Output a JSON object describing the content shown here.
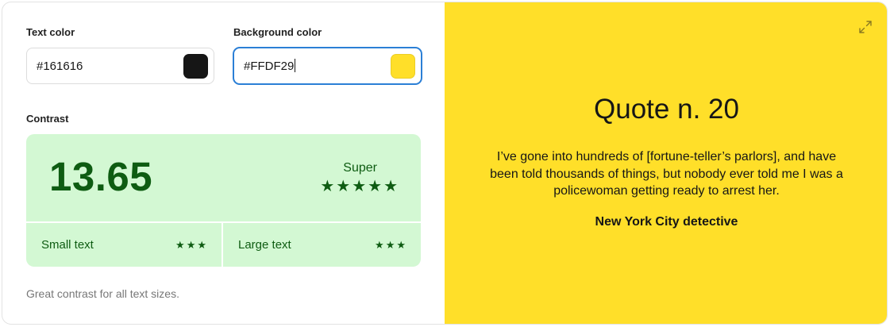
{
  "text_color": {
    "label": "Text color",
    "value": "#161616",
    "swatch": "#161616"
  },
  "background_color": {
    "label": "Background color",
    "value": "#FFDF29",
    "swatch": "#FFDF29"
  },
  "contrast": {
    "label": "Contrast",
    "ratio": "13.65",
    "rating": "Super",
    "rating_stars": 5,
    "small_text": {
      "label": "Small text",
      "stars": 3
    },
    "large_text": {
      "label": "Large text",
      "stars": 3
    },
    "accent_color": "#0e5c12",
    "panel_color": "#d3f8d3"
  },
  "note": "Great contrast for all text sizes.",
  "preview": {
    "title": "Quote n. 20",
    "quote": "I’ve gone into hundreds of [fortune-teller’s parlors], and have been told thousands of things, but nobody ever told me I was a policewoman getting ready to arrest her.",
    "author": "New York City detective",
    "expand_icon": "expand-icon"
  }
}
